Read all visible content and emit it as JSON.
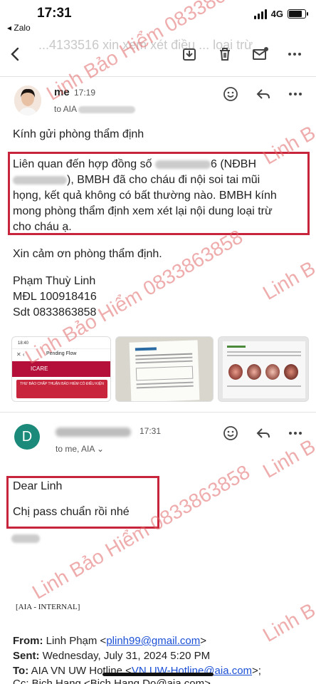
{
  "status_bar": {
    "time": "17:31",
    "back_app": "◂ Zalo",
    "network": "4G"
  },
  "toolbar": {
    "subject_faded": "...4133516 xin xem xét điều ... loại trừ"
  },
  "message1": {
    "sender": "me",
    "time": "17:19",
    "recipient": "to AIA",
    "greeting": "Kính gửi phòng thẩm định",
    "box_line1_a": "Liên quan đến hợp đồng số ",
    "box_line1_b": "6 (NĐBH",
    "box_line2": "), BMBH đã cho cháu đi nội soi tai mũi",
    "box_line3": "họng, kết quả không có bất thường nào. BMBH kính",
    "box_line4": "mong phòng thẩm định xem xét lại nội dung loại trừ",
    "box_line5": "cho cháu ạ.",
    "thanks": "Xin cảm ơn phòng thẩm định.",
    "sig_name": "Phạm Thuỳ Linh",
    "sig_mdl": "MĐL 100918416",
    "sig_phone": "Sdt 0833863858"
  },
  "attachment1": {
    "time": "18:40",
    "flow_title": "Pending Flow",
    "brand": "ICARE",
    "notice": "THƯ BÁO CHẤP THUẬN BẢO HIỂM CÓ ĐIỀU KIỆN"
  },
  "message2": {
    "avatar_letter": "D",
    "time": "17:31",
    "recipient": "to me, AIA",
    "dear_line": "Dear  Linh",
    "reply_line": "Chị pass chuẩn rồi nhé",
    "internal_label": "[AIA - INTERNAL]",
    "from_label": "From:",
    "from_name": "Linh Phạm <",
    "from_email": "plinh99@gmail.com",
    "from_end": ">",
    "sent_label": "Sent:",
    "sent_value": "Wednesday, July 31, 2024 5:20 PM",
    "to_label": "To:",
    "to_name": "AIA VN UW Hotline <",
    "to_email": "VN.UW-Hotline@aia.com",
    "to_end": ">;",
    "cc_partial": "Cc: Bich Hang <Bich.Hang.Do@aia.com>"
  },
  "watermark": {
    "text": "Linh Bảo Hiểm 0833863858",
    "short": "Linh B"
  },
  "colors": {
    "highlight_box": "#c8243b",
    "avatar_d": "#1b8a7a",
    "link": "#1a4fd6",
    "watermark": "#e36a6a"
  }
}
